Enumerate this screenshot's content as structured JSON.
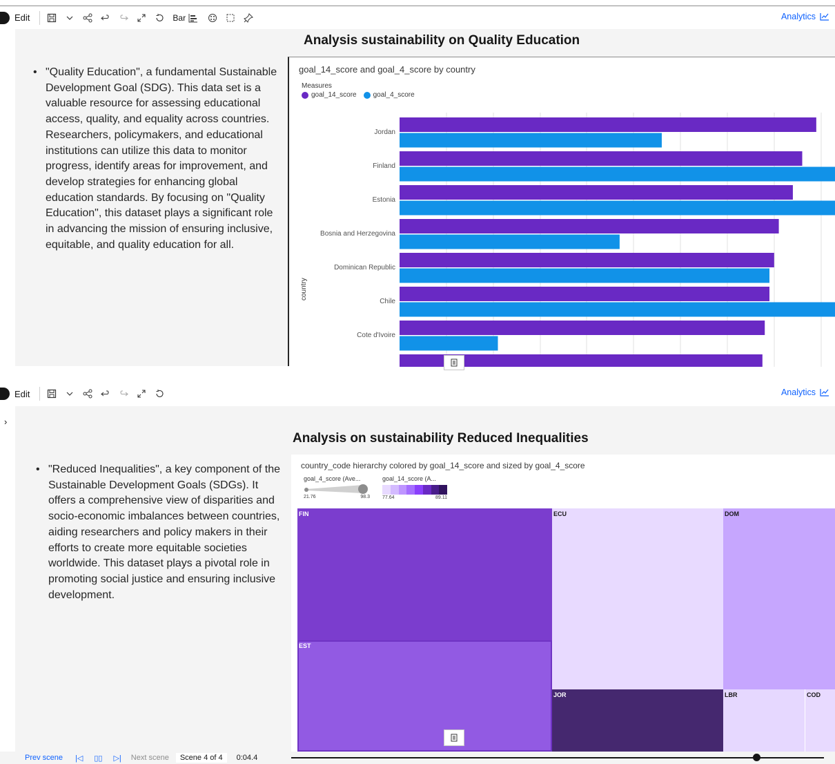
{
  "toolbar": {
    "edit_label": "Edit",
    "bar_label": "Bar",
    "analytics_label": "Analytics",
    "icons": [
      "save-icon",
      "chevron-down-icon",
      "share-icon",
      "undo-icon",
      "redo-icon",
      "expand-icon",
      "reset-icon",
      "bar-chart-icon",
      "color-icon",
      "select-icon",
      "pin-icon",
      "analytics-chart-icon"
    ]
  },
  "scene_top": {
    "title": "Analysis sustainability on Quality Education",
    "text": "\"Quality Education\", a fundamental Sustainable Development Goal (SDG). This data set is a valuable resource for assessing educational access, quality, and equality across countries. Researchers, policymakers, and educational institutions can utilize this data to monitor progress, identify areas for improvement, and develop strategies for enhancing global education standards. By focusing on \"Quality Education\", this dataset plays a significant role in advancing the mission of ensuring inclusive, equitable, and quality education for all."
  },
  "scene_bottom": {
    "title": "Analysis on sustainability Reduced Inequalities",
    "text": "\"Reduced Inequalities\", a key component of the Sustainable Development Goals (SDGs). It offers a comprehensive view of disparities and socio-economic imbalances between countries, aiding researchers and policy makers in their efforts to create more equitable societies worldwide. This dataset plays a pivotal role in promoting social justice and ensuring inclusive development."
  },
  "chart_data": [
    {
      "type": "bar",
      "orientation": "horizontal",
      "title": "goal_14_score and goal_4_score by country",
      "legend_title": "Measures",
      "ylabel": "country",
      "categories": [
        "Jordan",
        "Finland",
        "Estonia",
        "Bosnia and Herzegovina",
        "Dominican Republic",
        "Chile",
        "Cote d'Ivoire"
      ],
      "series": [
        {
          "name": "goal_14_score",
          "color": "#6929c4",
          "values": [
            89,
            86,
            84,
            81,
            80,
            79,
            78
          ]
        },
        {
          "name": "goal_4_score",
          "color": "#1192e8",
          "values": [
            56,
            96,
            98,
            47,
            79,
            93,
            21
          ]
        }
      ],
      "xlim": [
        0,
        93
      ],
      "legend_position": "top-left",
      "grid": true
    },
    {
      "type": "treemap",
      "title": "country_code hierarchy colored by goal_14_score and sized by goal_4_score",
      "size_legend": {
        "label": "goal_4_score (Ave...",
        "min": "21.76",
        "max": "98.3"
      },
      "color_legend": {
        "label": "goal_14_score (A...",
        "min": "77.64",
        "max": "89.11",
        "colors": [
          "#e8daff",
          "#d4bbff",
          "#be95ff",
          "#a56eff",
          "#8a3ffc",
          "#6929c4",
          "#491d8b",
          "#31135e"
        ]
      },
      "cells": [
        {
          "code": "FIN",
          "color": "#7b3dce"
        },
        {
          "code": "EST",
          "color": "#925ae3"
        },
        {
          "code": "ECU",
          "color": "#e8daff"
        },
        {
          "code": "DOM",
          "color": "#c6a6fe"
        },
        {
          "code": "JOR",
          "color": "#45286f"
        },
        {
          "code": "LBR",
          "color": "#e6d8ff"
        },
        {
          "code": "COD",
          "color": "#e8daff"
        }
      ]
    }
  ],
  "footer": {
    "prev": "Prev scene",
    "next": "Next scene",
    "scene": "Scene 4 of 4",
    "time": "0:04.4",
    "progress": 0.87
  }
}
